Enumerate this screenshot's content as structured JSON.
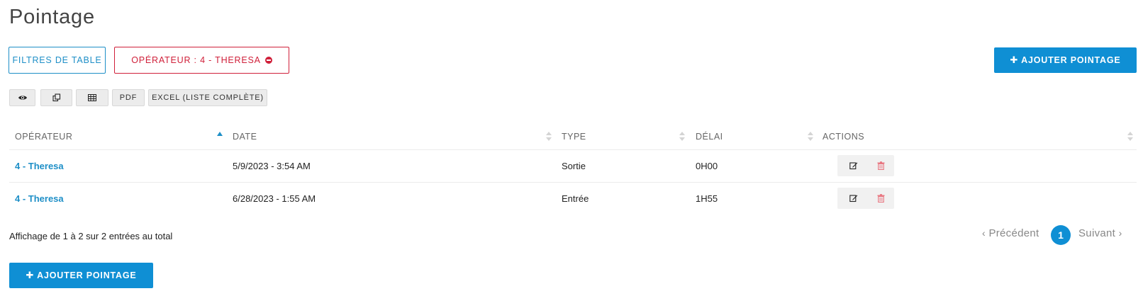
{
  "page": {
    "title": "Pointage"
  },
  "filters": {
    "table_filters_label": "FILTRES DE TABLE",
    "operator_filter_label": "OPÉRATEUR : 4 - THERESA"
  },
  "actions": {
    "add_label": "AJOUTER POINTAGE"
  },
  "toolbar": {
    "view_icon": "eye-icon",
    "copy_icon": "copy-icon",
    "csv_icon": "table-icon",
    "pdf_label": "PDF",
    "excel_label": "EXCEL (LISTE COMPLÈTE)"
  },
  "table": {
    "columns": [
      "OPÉRATEUR",
      "DATE",
      "TYPE",
      "DÉLAI",
      "ACTIONS"
    ],
    "sorted_column": "OPÉRATEUR",
    "rows": [
      {
        "operator": "4 - Theresa",
        "date": "5/9/2023 - 3:54 AM",
        "type": "Sortie",
        "delay": "0H00"
      },
      {
        "operator": "4 - Theresa",
        "date": "6/28/2023 - 1:55 AM",
        "type": "Entrée",
        "delay": "1H55"
      }
    ]
  },
  "pagination": {
    "info": "Affichage de 1 à 2 sur 2 entrées au total",
    "prev_label": "Précédent",
    "current_page": "1",
    "next_label": "Suivant"
  },
  "colors": {
    "accent": "#0f8fd4",
    "link": "#1e8fc7",
    "danger": "#d0203a"
  }
}
